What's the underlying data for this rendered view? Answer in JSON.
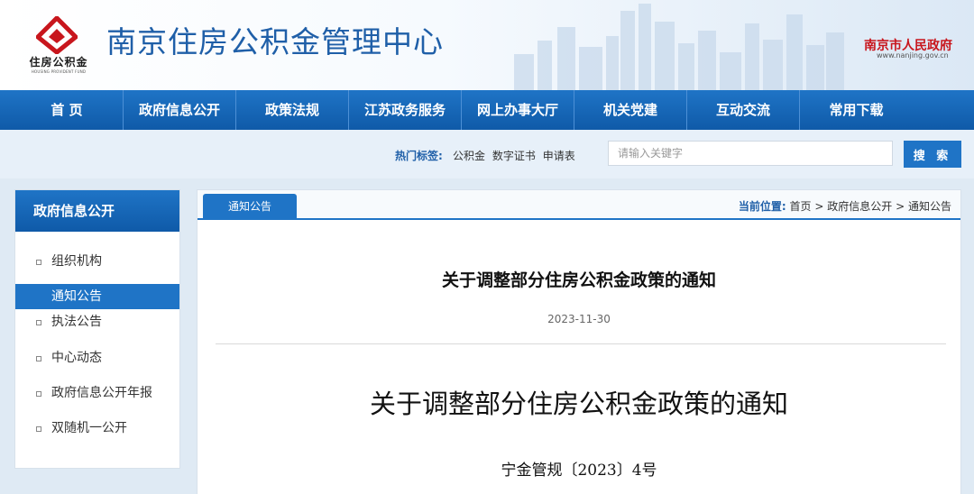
{
  "header": {
    "logo_text": "住房公积金",
    "logo_subtext": "HOUSING PROVIDENT FUND",
    "site_title": "南京住房公积金管理中心",
    "gov_link_text": "南京市人民政府",
    "gov_link_url_text": "www.nanjing.gov.cn",
    "brand_color": "#1f5fa8",
    "logo_color": "#c8161d"
  },
  "nav": {
    "items": [
      "首 页",
      "政府信息公开",
      "政策法规",
      "江苏政务服务",
      "网上办事大厅",
      "机关党建",
      "互动交流",
      "常用下载"
    ]
  },
  "search": {
    "hot_label": "热门标签:",
    "hot_tags": [
      "公积金",
      "数字证书",
      "申请表"
    ],
    "placeholder": "请输入关键字",
    "button_label": "搜 索"
  },
  "sidebar": {
    "title": "政府信息公开",
    "items": [
      {
        "label": "组织机构",
        "active": false
      },
      {
        "label": "通知公告",
        "active": true
      },
      {
        "label": "执法公告",
        "active": false
      },
      {
        "label": "中心动态",
        "active": false
      },
      {
        "label": "政府信息公开年报",
        "active": false
      },
      {
        "label": "双随机一公开",
        "active": false
      }
    ]
  },
  "main": {
    "tab_label": "通知公告",
    "breadcrumb_label": "当前位置:",
    "breadcrumb": [
      "首页",
      "政府信息公开",
      "通知公告"
    ],
    "breadcrumb_sep": ">",
    "article_title": "关于调整部分住房公积金政策的通知",
    "date": "2023-11-30",
    "doc_title": "关于调整部分住房公积金政策的通知",
    "doc_number": "宁金管规〔2023〕4号"
  }
}
